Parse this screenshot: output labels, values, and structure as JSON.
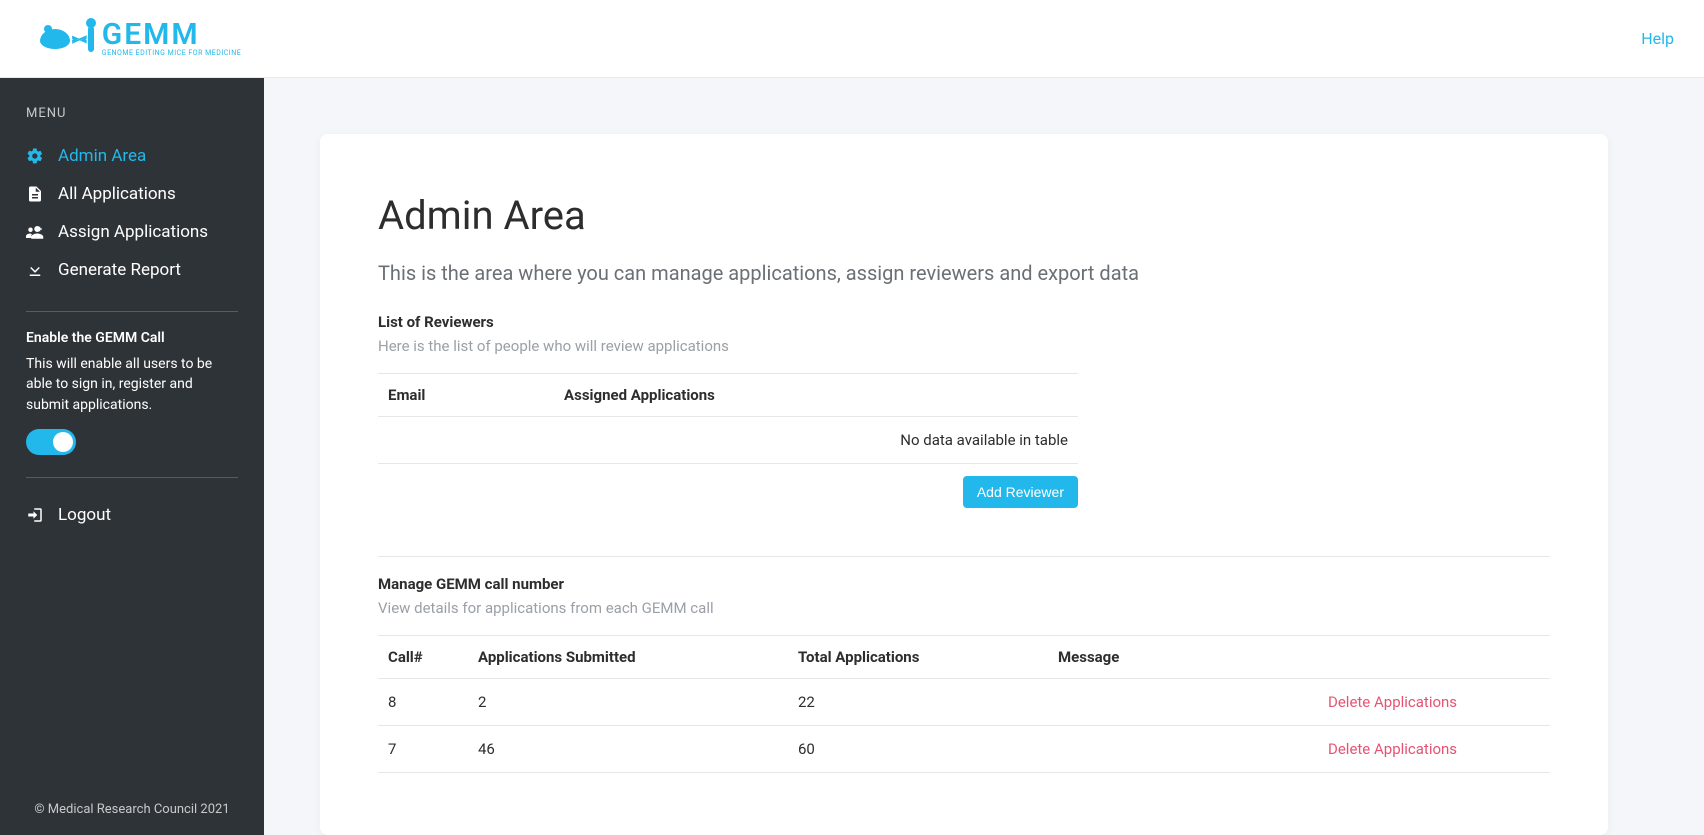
{
  "header": {
    "logo_main": "GEMM",
    "logo_sub": "GENOME EDITING MICE FOR MEDICINE",
    "help_label": "Help"
  },
  "sidebar": {
    "menu_label": "MENU",
    "items": [
      {
        "label": "Admin Area",
        "icon": "gear-icon",
        "active": true
      },
      {
        "label": "All Applications",
        "icon": "document-icon",
        "active": false
      },
      {
        "label": "Assign Applications",
        "icon": "people-plus-icon",
        "active": false
      },
      {
        "label": "Generate Report",
        "icon": "download-icon",
        "active": false
      }
    ],
    "toggle": {
      "title": "Enable the GEMM Call",
      "description": "This will enable all users to be able to sign in, register and submit applications.",
      "on": true
    },
    "logout_label": "Logout",
    "footer": "© Medical Research Council 2021"
  },
  "main": {
    "title": "Admin Area",
    "subtitle": "This is the area where you can manage applications, assign reviewers and export data",
    "reviewers": {
      "title": "List of Reviewers",
      "description": "Here is the list of people who will review applications",
      "columns": [
        "Email",
        "Assigned Applications"
      ],
      "no_data": "No data available in table",
      "add_button": "Add Reviewer"
    },
    "calls": {
      "title": "Manage GEMM call number",
      "description": "View details for applications from each GEMM call",
      "columns": [
        "Call#",
        "Applications Submitted",
        "Total Applications",
        "Message"
      ],
      "delete_label": "Delete Applications",
      "rows": [
        {
          "call": "8",
          "submitted": "2",
          "total": "22",
          "message": ""
        },
        {
          "call": "7",
          "submitted": "46",
          "total": "60",
          "message": ""
        }
      ]
    }
  }
}
